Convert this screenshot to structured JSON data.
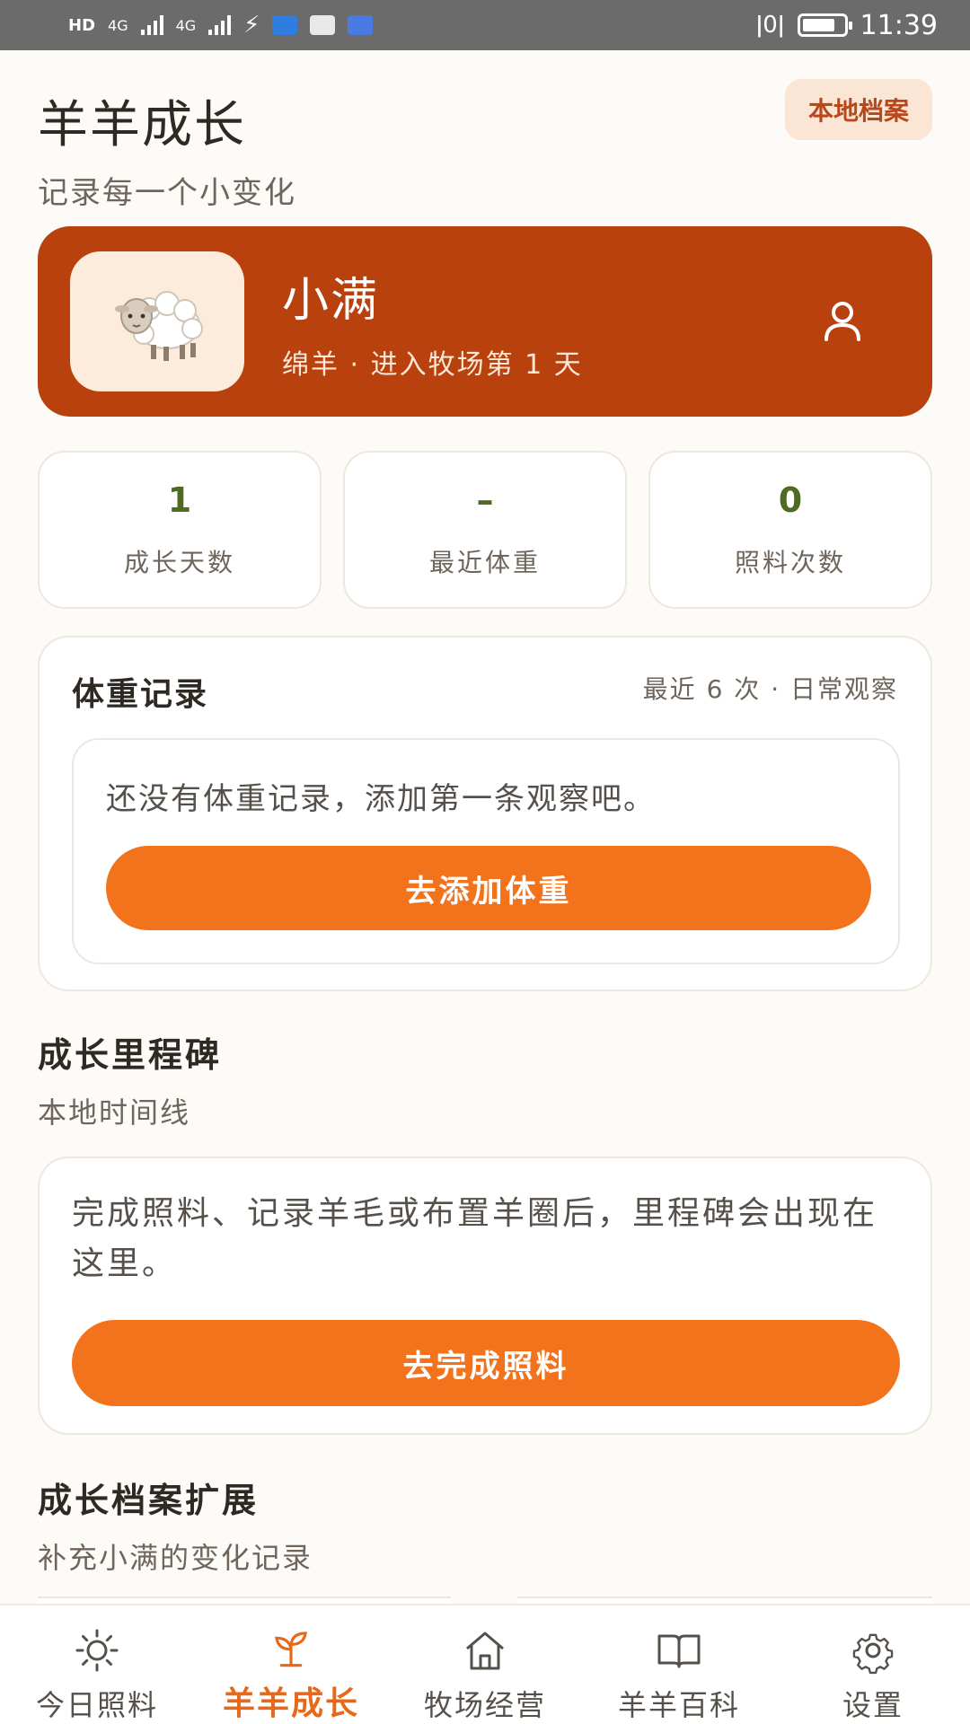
{
  "status_bar": {
    "time": "11:39",
    "net_label_1": "HD",
    "net_label_2": "HD",
    "signal_1_label": "4G",
    "signal_2_label": "4G"
  },
  "header": {
    "title": "羊羊成长",
    "subtitle": "记录每一个小变化",
    "archive_badge": "本地档案"
  },
  "profile": {
    "name": "小满",
    "meta": "绵羊 · 进入牧场第 1 天",
    "avatar_icon": "sheep-icon",
    "action_icon": "person-icon"
  },
  "stats": [
    {
      "value": "1",
      "label": "成长天数"
    },
    {
      "value": "–",
      "label": "最近体重"
    },
    {
      "value": "0",
      "label": "照料次数"
    }
  ],
  "weight": {
    "title": "体重记录",
    "meta": "最近 6 次 · 日常观察",
    "empty_text": "还没有体重记录，添加第一条观察吧。",
    "button": "去添加体重"
  },
  "milestones": {
    "title": "成长里程碑",
    "subtitle": "本地时间线",
    "empty_text": "完成照料、记录羊毛或布置羊圈后，里程碑会出现在这里。",
    "button": "去完成照料"
  },
  "extension": {
    "title": "成长档案扩展",
    "subtitle": "补充小满的变化记录"
  },
  "tabs": [
    {
      "label": "今日照料",
      "icon": "sun-icon",
      "active": false
    },
    {
      "label": "羊羊成长",
      "icon": "sprout-icon",
      "active": true
    },
    {
      "label": "牧场经营",
      "icon": "home-icon",
      "active": false
    },
    {
      "label": "羊羊百科",
      "icon": "book-icon",
      "active": false
    },
    {
      "label": "设置",
      "icon": "gear-icon",
      "active": false
    }
  ],
  "colors": {
    "accent": "#f2731c",
    "profile_bg": "#b8410e",
    "active_tab": "#e8681a",
    "stat_value": "#4d6b22"
  }
}
